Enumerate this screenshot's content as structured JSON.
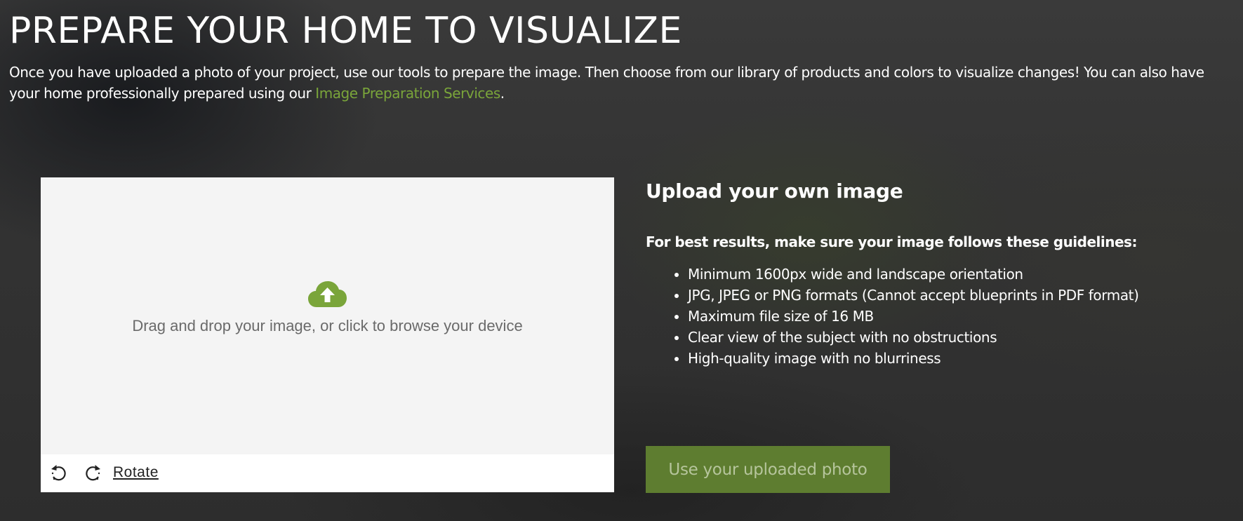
{
  "header": {
    "title": "PREPARE YOUR HOME TO VISUALIZE",
    "intro_text": "Once you have uploaded a photo of your project, use our tools to prepare the image. Then choose from our library of products and colors to visualize changes! You can also have your home professionally prepared using our ",
    "intro_link": "Image Preparation Services",
    "intro_end": "."
  },
  "dropzone": {
    "icon": "cloud-upload-icon",
    "text": "Drag and drop your image, or click to browse your device"
  },
  "toolbar": {
    "rotate_left_icon": "rotate-left-icon",
    "rotate_right_icon": "rotate-right-icon",
    "rotate_label": "Rotate"
  },
  "upload": {
    "heading": "Upload your own image",
    "guidelines_heading": "For best results, make sure your image follows these guidelines:",
    "guidelines": [
      "Minimum 1600px wide and landscape orientation",
      "JPG, JPEG or PNG formats (Cannot accept blueprints in PDF format)",
      "Maximum file size of 16 MB",
      "Clear view of the subject with no obstructions",
      "High-quality image with no blurriness"
    ],
    "button_label": "Use your uploaded photo"
  },
  "colors": {
    "accent_green": "#7aa53a",
    "button_green": "#5e7d30",
    "button_text": "#b6c59c",
    "dropzone_bg": "#f4f4f4"
  }
}
